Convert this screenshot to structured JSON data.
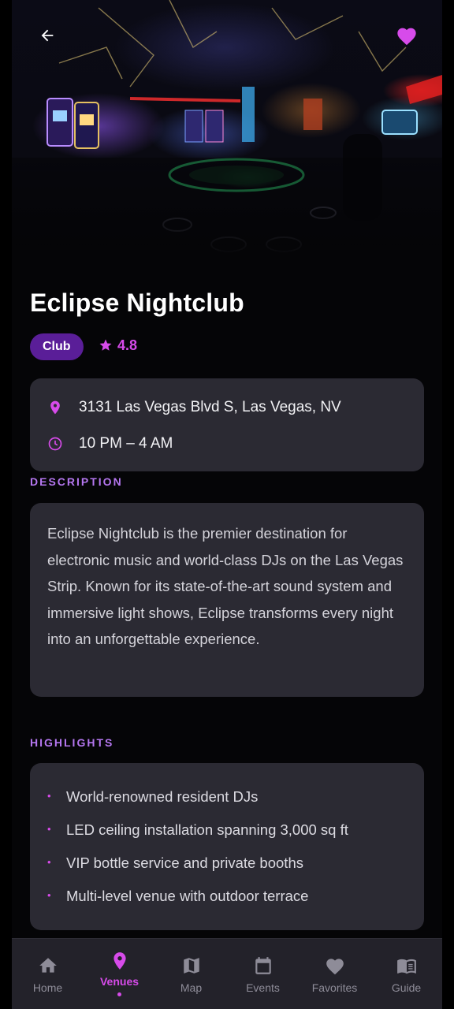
{
  "venue": {
    "name": "Eclipse Nightclub",
    "category": "Club",
    "rating": "4.8",
    "address": "3131 Las Vegas Blvd S, Las Vegas, NV",
    "hours": "10 PM – 4 AM"
  },
  "sections": {
    "description_label": "DESCRIPTION",
    "highlights_label": "HIGHLIGHTS"
  },
  "description": "Eclipse Nightclub is the premier destination for electronic music and world-class DJs on the Las Vegas Strip. Known for its state-of-the-art sound system and immersive light shows, Eclipse transforms every night into an unforgettable experience.",
  "highlights": [
    "World-renowned resident DJs",
    "LED ceiling installation spanning 3,000 sq ft",
    "VIP bottle service and private booths",
    "Multi-level venue with outdoor terrace"
  ],
  "nav": {
    "items": [
      {
        "label": "Home",
        "icon": "home-icon"
      },
      {
        "label": "Venues",
        "icon": "location-pin-icon",
        "active": true
      },
      {
        "label": "Map",
        "icon": "map-icon"
      },
      {
        "label": "Events",
        "icon": "calendar-icon"
      },
      {
        "label": "Favorites",
        "icon": "heart-icon"
      },
      {
        "label": "Guide",
        "icon": "book-icon"
      }
    ]
  },
  "colors": {
    "accent": "#d74bea",
    "badge_bg": "#5a1e98",
    "card_bg": "#2b2a33",
    "section_label": "#b577f0",
    "nav_bg": "#23222a",
    "nav_inactive": "#8e8c98"
  }
}
